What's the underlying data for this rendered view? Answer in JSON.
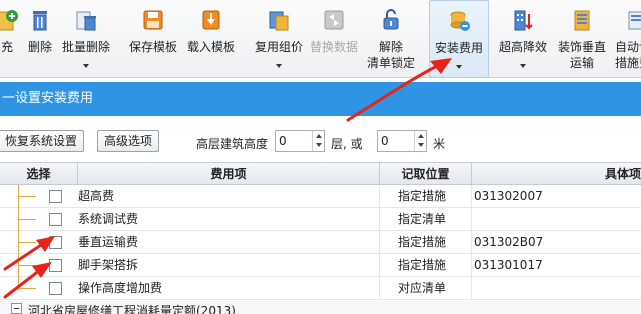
{
  "toolbar": {
    "items": [
      {
        "label": "充",
        "icon": "add-icon"
      },
      {
        "label": "删除",
        "icon": "delete-icon"
      },
      {
        "label": "批量删除",
        "icon": "batch-delete-icon"
      },
      {
        "label": "保存模板",
        "icon": "save-template-icon"
      },
      {
        "label": "载入模板",
        "icon": "load-template-icon"
      },
      {
        "label": "复用组价",
        "icon": "reuse-price-icon"
      },
      {
        "label": "替换数据",
        "icon": "replace-data-icon"
      },
      {
        "label": "解除",
        "label2": "清单锁定",
        "icon": "unlock-icon"
      },
      {
        "label": "安装费用",
        "icon": "install-fee-icon"
      },
      {
        "label": "超高降效",
        "icon": "height-efficiency-icon"
      },
      {
        "label": "装饰垂直",
        "label2": "运输",
        "icon": "vertical-transport-icon"
      },
      {
        "label": "自动计",
        "label2": "措施费",
        "icon": "auto-measure-icon"
      }
    ]
  },
  "title": "一设置安装费用",
  "options": {
    "restore_label": "恢复系统设置",
    "advanced_label": "高级选项",
    "height_label": "高层建筑高度",
    "height_value": "0",
    "floor_label": "层, 或",
    "floor_value": "0",
    "unit_label": "米"
  },
  "grid": {
    "columns": [
      "选择",
      "费用项",
      "记取位置",
      "具体项"
    ],
    "rows": [
      {
        "name": "超高费",
        "position": "指定措施",
        "item": "031302007"
      },
      {
        "name": "系统调试费",
        "position": "指定清单",
        "item": ""
      },
      {
        "name": "垂直运输费",
        "position": "指定措施",
        "item": "031302B07"
      },
      {
        "name": "脚手架搭拆",
        "position": "指定措施",
        "item": "031301017"
      },
      {
        "name": "操作高度增加费",
        "position": "对应清单",
        "item": ""
      }
    ],
    "group_label": "河北省房屋修缮工程消耗量定额(2013)"
  },
  "colors": {
    "title_bar": "#2f94e3",
    "annotation_arrow": "#e8231c",
    "tree_line": "#e0a840"
  }
}
